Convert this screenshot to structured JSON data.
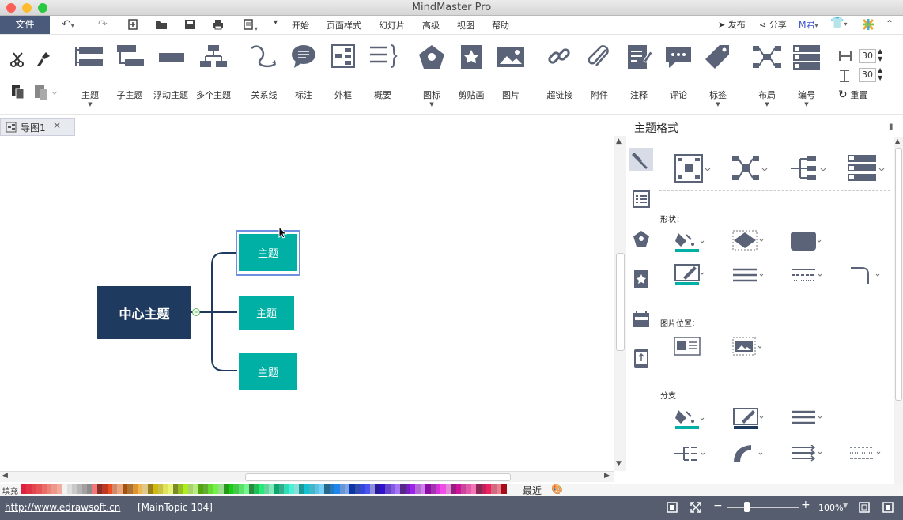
{
  "window": {
    "title": "MindMaster Pro"
  },
  "menubar": {
    "file": "文件",
    "items": [
      "开始",
      "页面样式",
      "幻灯片",
      "高级",
      "视图",
      "帮助"
    ],
    "publish": "发布",
    "share": "分享",
    "user": "M君"
  },
  "ribbon": {
    "tools": [
      {
        "label": "主题",
        "icon": "topic-icon"
      },
      {
        "label": "子主题",
        "icon": "subtopic-icon"
      },
      {
        "label": "浮动主题",
        "icon": "floating-topic-icon"
      },
      {
        "label": "多个主题",
        "icon": "multiple-topics-icon"
      },
      {
        "label": "关系线",
        "icon": "relationship-icon"
      },
      {
        "label": "标注",
        "icon": "callout-icon"
      },
      {
        "label": "外框",
        "icon": "boundary-icon"
      },
      {
        "label": "概要",
        "icon": "summary-icon"
      },
      {
        "label": "图标",
        "icon": "icon-icon"
      },
      {
        "label": "剪贴画",
        "icon": "clipart-icon"
      },
      {
        "label": "图片",
        "icon": "picture-icon"
      },
      {
        "label": "超链接",
        "icon": "hyperlink-icon"
      },
      {
        "label": "附件",
        "icon": "attachment-icon"
      },
      {
        "label": "注释",
        "icon": "note-icon"
      },
      {
        "label": "评论",
        "icon": "comment-icon"
      },
      {
        "label": "标签",
        "icon": "tag-icon"
      },
      {
        "label": "布局",
        "icon": "layout-icon"
      },
      {
        "label": "编号",
        "icon": "numbering-icon"
      }
    ],
    "spacing_h": "30",
    "spacing_v": "30",
    "reset": "重置"
  },
  "doc_tab": {
    "label": "导图1"
  },
  "mindmap": {
    "central": "中心主题",
    "topics": [
      "主题",
      "主题",
      "主题"
    ]
  },
  "panel": {
    "title": "主题格式",
    "shape_label": "形状：",
    "image_pos_label": "图片位置：",
    "branch_label": "分支："
  },
  "palette": {
    "fill_label": "填充",
    "recent_label": "最近"
  },
  "status": {
    "url": "http://www.edrawsoft.cn",
    "selection": "[MainTopic 104]",
    "zoom": "100%"
  },
  "colors": {
    "central_fill": "#1f3a5f",
    "topic_fill": "#00b0a4",
    "selection": "#6f8fe0",
    "status_bg": "#555d6f",
    "file_tab": "#4a5a7a"
  }
}
